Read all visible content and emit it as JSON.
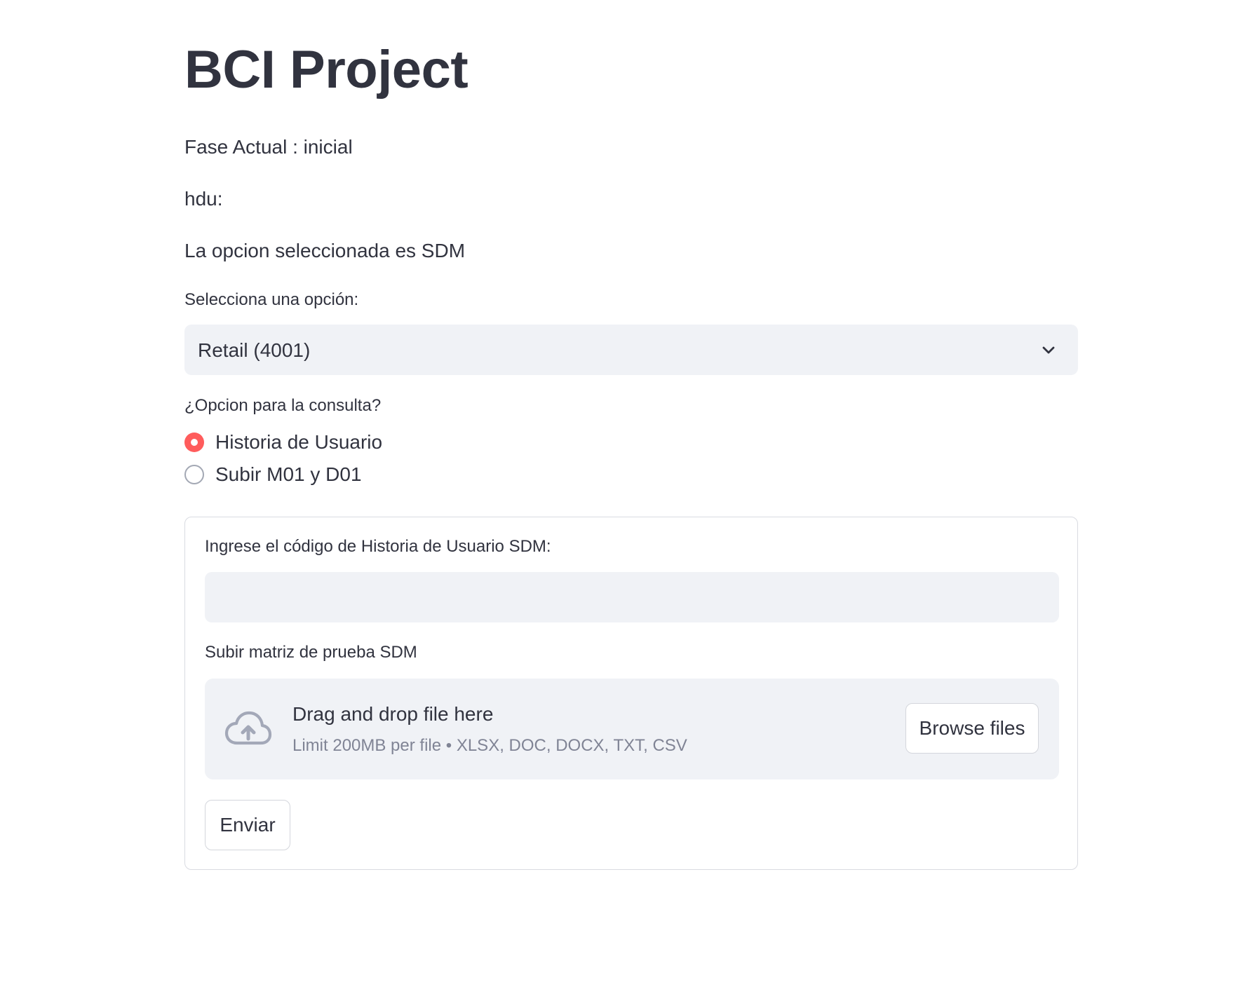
{
  "title": "BCI Project",
  "status": {
    "phase": "Fase Actual : inicial",
    "hdu": "hdu:",
    "selected_option": "La opcion seleccionada es SDM"
  },
  "select": {
    "label": "Selecciona una opción:",
    "value": "Retail (4001)",
    "icon": "chevron-down-icon"
  },
  "radio": {
    "label": "¿Opcion para la consulta?",
    "options": [
      {
        "label": "Historia de Usuario",
        "selected": true
      },
      {
        "label": "Subir M01 y D01",
        "selected": false
      }
    ],
    "accent_color": "#ff4b4b"
  },
  "form": {
    "code_label": "Ingrese el código de Historia de Usuario SDM:",
    "code_value": "",
    "upload_label": "Subir matriz de prueba SDM",
    "dropzone": {
      "icon": "cloud-upload-icon",
      "main_text": "Drag and drop file here",
      "sub_text": "Limit 200MB per file • XLSX, DOC, DOCX, TXT, CSV",
      "browse_label": "Browse files"
    },
    "submit_label": "Enviar"
  }
}
